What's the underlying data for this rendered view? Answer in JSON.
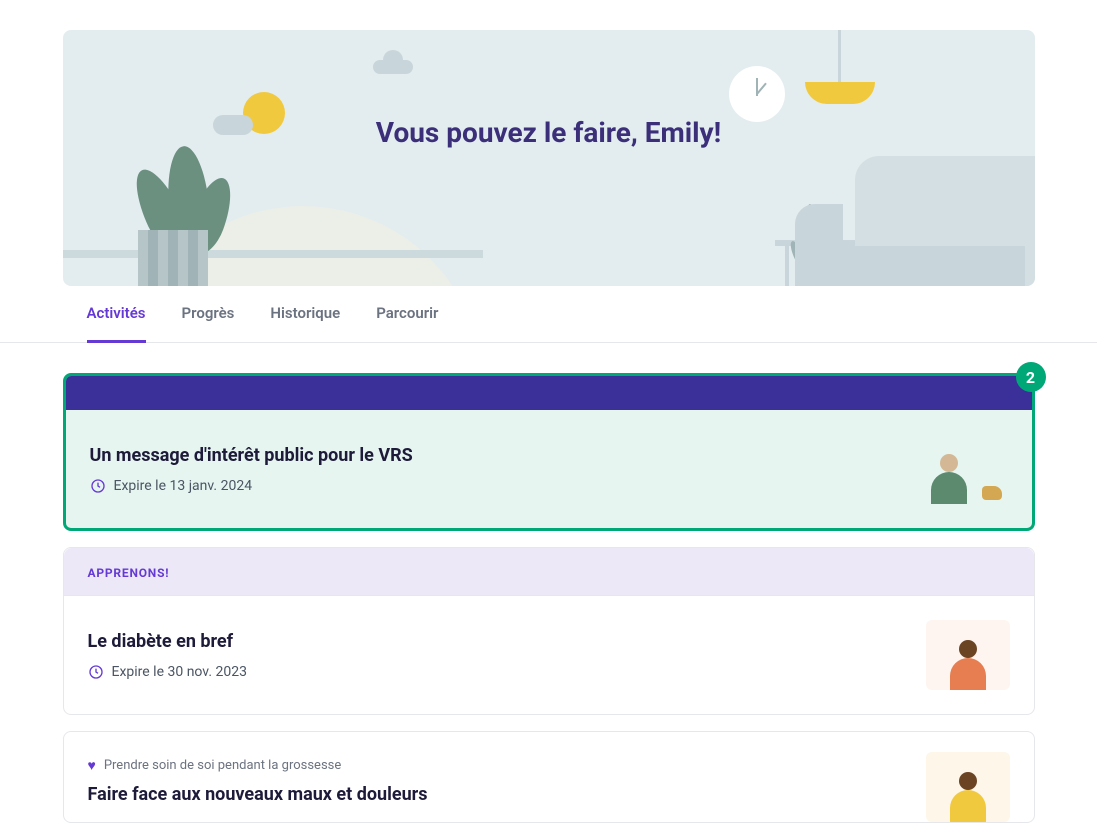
{
  "hero": {
    "title": "Vous pouvez le faire, Emily!"
  },
  "tabs": [
    {
      "label": "Activités",
      "active": true
    },
    {
      "label": "Progrès",
      "active": false
    },
    {
      "label": "Historique",
      "active": false
    },
    {
      "label": "Parcourir",
      "active": false
    }
  ],
  "cards": [
    {
      "featured": true,
      "badge": "2",
      "title": "Un message d'intérêt public pour le VRS",
      "meta": "Expire le 13 janv. 2024"
    },
    {
      "header": "APPRENONS!",
      "title": "Le diabète en bref",
      "meta": "Expire le 30 nov. 2023"
    },
    {
      "tag": "Prendre soin de soi pendant la grossesse",
      "title": "Faire face aux nouveaux maux et douleurs"
    }
  ],
  "colors": {
    "accent": "#6539d4",
    "success": "#00a878",
    "heroBg": "#e3edef"
  }
}
